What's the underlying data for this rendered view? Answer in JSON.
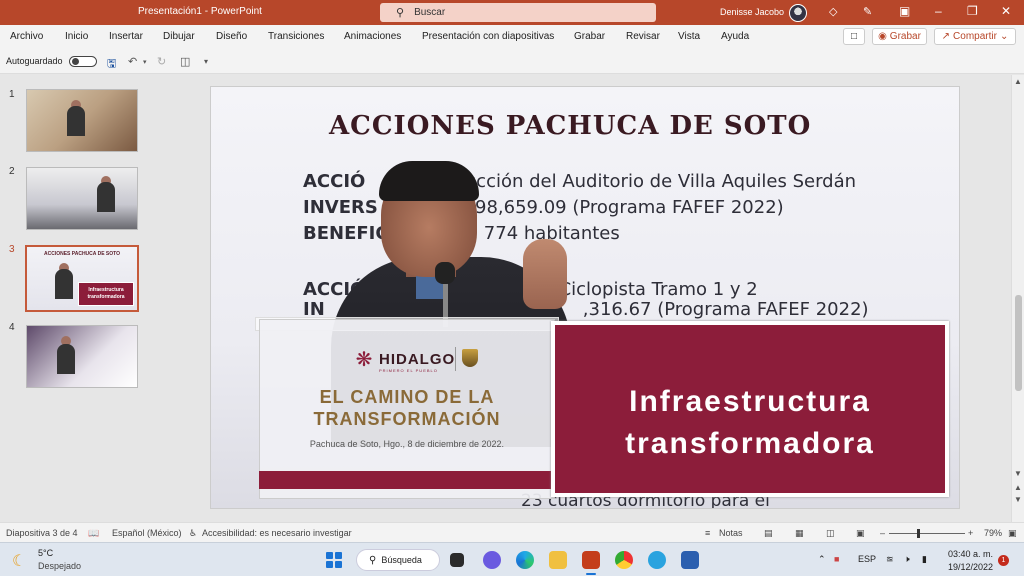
{
  "window": {
    "title": "Presentación1 - PowerPoint",
    "search_label": "Buscar",
    "user_name": "Denisse Jacobo"
  },
  "menu": {
    "items": [
      "Archivo",
      "Inicio",
      "Insertar",
      "Dibujar",
      "Diseño",
      "Transiciones",
      "Animaciones",
      "Presentación con diapositivas",
      "Grabar",
      "Revisar",
      "Vista",
      "Ayuda"
    ],
    "record_button": "Grabar",
    "share_button": "Compartir"
  },
  "quick_toolbar": {
    "autosave_label": "Autoguardado"
  },
  "thumbnails": {
    "numbers": [
      "1",
      "2",
      "3",
      "4"
    ],
    "selected": 3,
    "slide3_title": "ACCIONES PACHUCA DE SOTO",
    "slide3_banner": "Infraestructura transformadora"
  },
  "slide": {
    "title": "ACCIONES PACHUCA DE SOTO",
    "line1_a": "ACCIÓ",
    "line1_b": "rucción del Auditorio de Villa Aquiles Serdán",
    "line2_a": "INVERS",
    "line2_b": ",798,659.09 (Programa FAFEF 2022)",
    "line3_a": "BENEFIC",
    "line3_b": "S: 774 habitantes",
    "line4_a": "ACCIÓ",
    "line4_b": "de Ciclopista Tramo 1 y 2",
    "line5_a": "IN",
    "line5_b": ",316.67 (Programa FAFEF 2022)",
    "line6": "23 cuartos dormitorio para el",
    "podium_logo": "HIDALGO",
    "podium_logo_sub": "PRIMERO EL PUEBLO",
    "podium_line1": "EL CAMINO DE LA",
    "podium_line2": "TRANSFORMACIÓN",
    "podium_date": "Pachuca de Soto, Hgo., 8 de diciembre de 2022.",
    "banner_line1": "Infraestructura",
    "banner_line2": "transformadora"
  },
  "status": {
    "slide_counter": "Diapositiva 3 de 4",
    "language": "Español (México)",
    "accessibility": "Accesibilidad: es necesario investigar",
    "notes": "Notas",
    "zoom": "79%"
  },
  "taskbar": {
    "temperature": "5°C",
    "weather": "Despejado",
    "search_label": "Búsqueda",
    "language": "ESP",
    "time": "03:40 a. m.",
    "date": "19/12/2022",
    "notification_count": "1"
  },
  "colors": {
    "accent": "#b7472a",
    "banner": "#8c1d3a"
  }
}
